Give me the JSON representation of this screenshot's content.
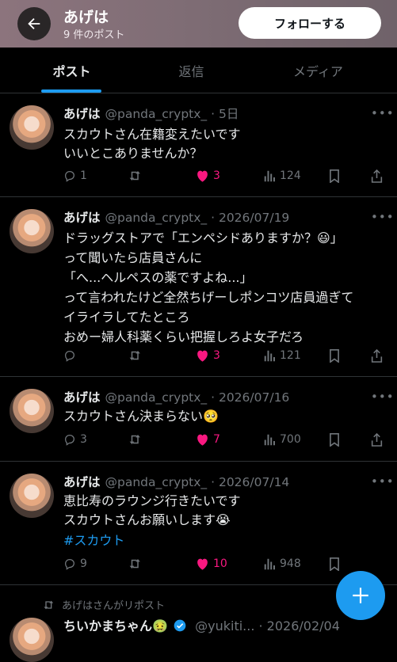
{
  "header": {
    "name": "あげは",
    "post_count": "9 件のポスト",
    "follow_label": "フォローする"
  },
  "tabs": [
    "ポスト",
    "返信",
    "メディア"
  ],
  "posts": [
    {
      "name": "あげは",
      "handle_date": "@panda_cryptx_ · 5日",
      "text": "スカウトさん在籍変えたいです\nいいとこありませんか？",
      "replies": "1",
      "reposts": "",
      "likes": "3",
      "views": "124"
    },
    {
      "name": "あげは",
      "handle_date": "@panda_cryptx_ · 2026/07/19",
      "text": "ドラッグストアで「エンペシドありますか？😃」\nって聞いたら店員さんに\n「へ...ヘルペスの薬ですよね...」\nって言われたけど全然ちげーしポンコツ店員過ぎて\nイライラしてたところ\nおめー婦人科薬くらい把握しろよ女子だろ",
      "replies": "",
      "reposts": "",
      "likes": "3",
      "views": "121"
    },
    {
      "name": "あげは",
      "handle_date": "@panda_cryptx_ · 2026/07/16",
      "text": "スカウトさん決まらない🥺",
      "replies": "3",
      "reposts": "",
      "likes": "7",
      "views": "700"
    },
    {
      "name": "あげは",
      "handle_date": "@panda_cryptx_ · 2026/07/14",
      "text": "恵比寿のラウンジ行きたいです\nスカウトさんお願いします😭",
      "hashtag": "#スカウト",
      "replies": "9",
      "reposts": "",
      "likes": "10",
      "views": "948"
    }
  ],
  "repost": {
    "note": "あげはさんがリポスト",
    "name": "ちいかまちゃん🤢",
    "handle_date": "@yukiti... · 2026/02/04"
  },
  "colors": {
    "accent": "#1d9bf0",
    "like": "#f91880",
    "muted": "#71767b",
    "background": "#000000",
    "divider": "#2f3336"
  },
  "icons": [
    "back-arrow-icon",
    "reply-icon",
    "repost-icon",
    "heart-icon",
    "views-icon",
    "bookmark-icon",
    "share-icon",
    "more-icon",
    "plus-icon",
    "verified-icon"
  ]
}
